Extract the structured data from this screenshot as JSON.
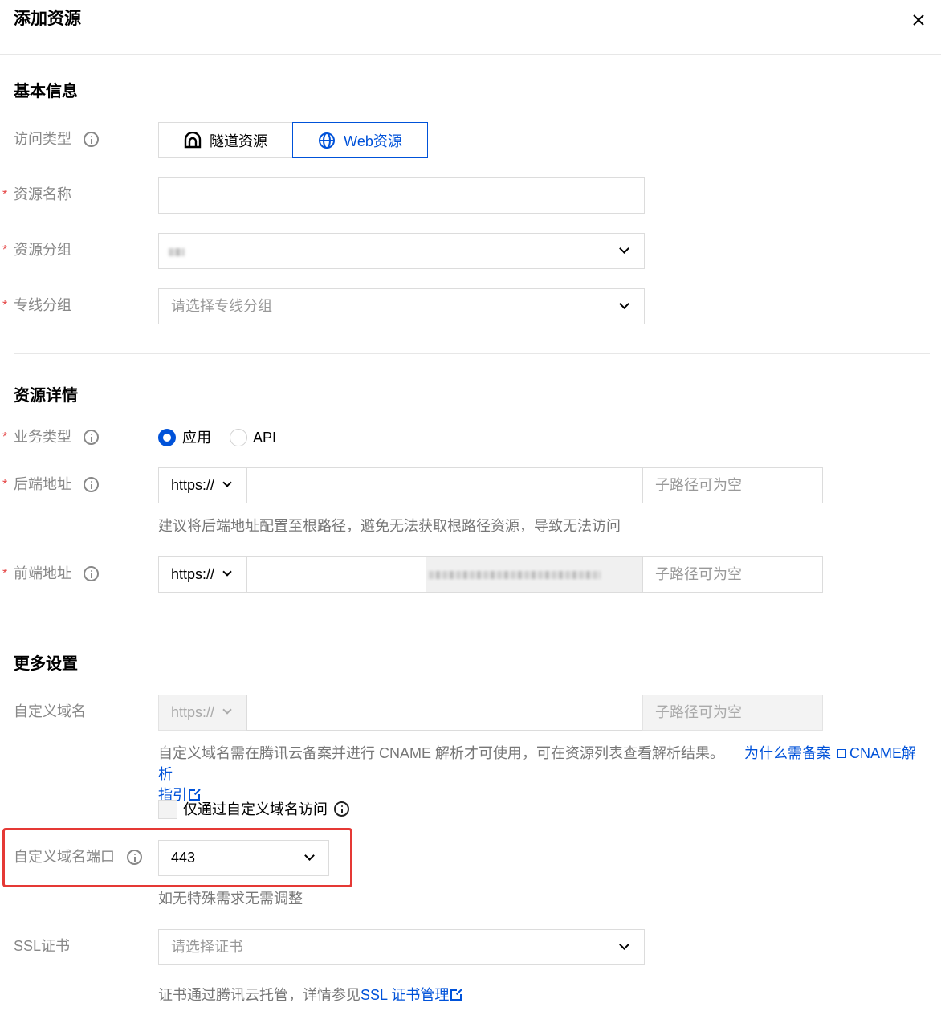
{
  "dialog": {
    "title": "添加资源"
  },
  "sections": {
    "basic": "基本信息",
    "details": "资源详情",
    "more": "更多设置"
  },
  "basic": {
    "access_type": {
      "label": "访问类型",
      "options": [
        "隧道资源",
        "Web资源"
      ],
      "selected": "Web资源"
    },
    "resource_name": {
      "label": "资源名称",
      "value": ""
    },
    "resource_group": {
      "label": "资源分组",
      "value": ""
    },
    "line_group": {
      "label": "专线分组",
      "placeholder": "请选择专线分组"
    }
  },
  "details": {
    "business_type": {
      "label": "业务类型",
      "options": [
        "应用",
        "API"
      ],
      "selected": "应用"
    },
    "backend": {
      "label": "后端地址",
      "protocol": "https://",
      "subpath_placeholder": "子路径可为空",
      "helper": "建议将后端地址配置至根路径，避免无法获取根路径资源，导致无法访问"
    },
    "frontend": {
      "label": "前端地址",
      "protocol": "https://",
      "subpath_placeholder": "子路径可为空"
    }
  },
  "more": {
    "custom_domain": {
      "label": "自定义域名",
      "protocol": "https://",
      "subpath_placeholder": "子路径可为空",
      "helper": "自定义域名需在腾讯云备案并进行 CNAME 解析才可使用，可在资源列表查看解析结果。",
      "link_why": "为什么需备案",
      "link_cname": "CNAME解析",
      "link_cname_tail": "指引",
      "only_checkbox": "仅通过自定义域名访问"
    },
    "custom_port": {
      "label": "自定义域名端口",
      "value": "443",
      "helper": "如无特殊需求无需调整"
    },
    "ssl": {
      "label": "SSL证书",
      "placeholder": "请选择证书",
      "helper": "证书通过腾讯云托管，详情参见",
      "link": "SSL 证书管理"
    }
  },
  "colors": {
    "brand": "#0052d9",
    "required": "#e54545",
    "highlight": "#e53935"
  }
}
